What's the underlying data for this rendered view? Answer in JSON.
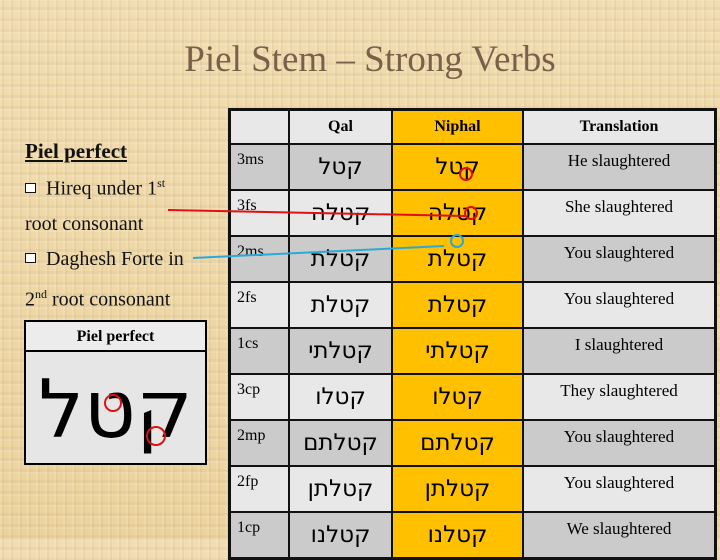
{
  "title": "Piel Stem – Strong Verbs",
  "notes": {
    "heading": "Piel perfect",
    "bullet1_a": "Hireq under 1",
    "bullet1_sup": "st",
    "bullet1_b": "root consonant",
    "bullet2_a": "Daghesh Forte in",
    "bullet2_num": "2",
    "bullet2_sup": "nd",
    "bullet2_b": " root consonant"
  },
  "piel_box": {
    "label": "Piel perfect",
    "word": "קטל"
  },
  "table": {
    "headers": [
      "",
      "Qal",
      "Niphal",
      "Translation"
    ],
    "rows": [
      {
        "pgn": "3ms",
        "qal": "קטל",
        "niphal": "קטל",
        "translation": "He slaughtered"
      },
      {
        "pgn": "3fs",
        "qal": "קטלה",
        "niphal": "קטלה",
        "translation": "She slaughtered"
      },
      {
        "pgn": "2ms",
        "qal": "קטלת",
        "niphal": "קטלת",
        "translation": "You slaughtered"
      },
      {
        "pgn": "2fs",
        "qal": "קטלת",
        "niphal": "קטלת",
        "translation": "You slaughtered"
      },
      {
        "pgn": "1cs",
        "qal": "קטלתי",
        "niphal": "קטלתי",
        "translation": "I slaughtered"
      },
      {
        "pgn": "3cp",
        "qal": "קטלו",
        "niphal": "קטלו",
        "translation": "They slaughtered"
      },
      {
        "pgn": "2mp",
        "qal": "קטלתם",
        "niphal": "קטלתם",
        "translation": "You slaughtered"
      },
      {
        "pgn": "2fp",
        "qal": "קטלתן",
        "niphal": "קטלתן",
        "translation": "You slaughtered"
      },
      {
        "pgn": "1cp",
        "qal": "קטלנו",
        "niphal": "קטלנו",
        "translation": "We slaughtered"
      }
    ]
  },
  "colors": {
    "highlight": "#ffc000",
    "annotation_red": "#e01010",
    "annotation_blue": "#2aa8d8",
    "title": "#7a5f4a"
  }
}
